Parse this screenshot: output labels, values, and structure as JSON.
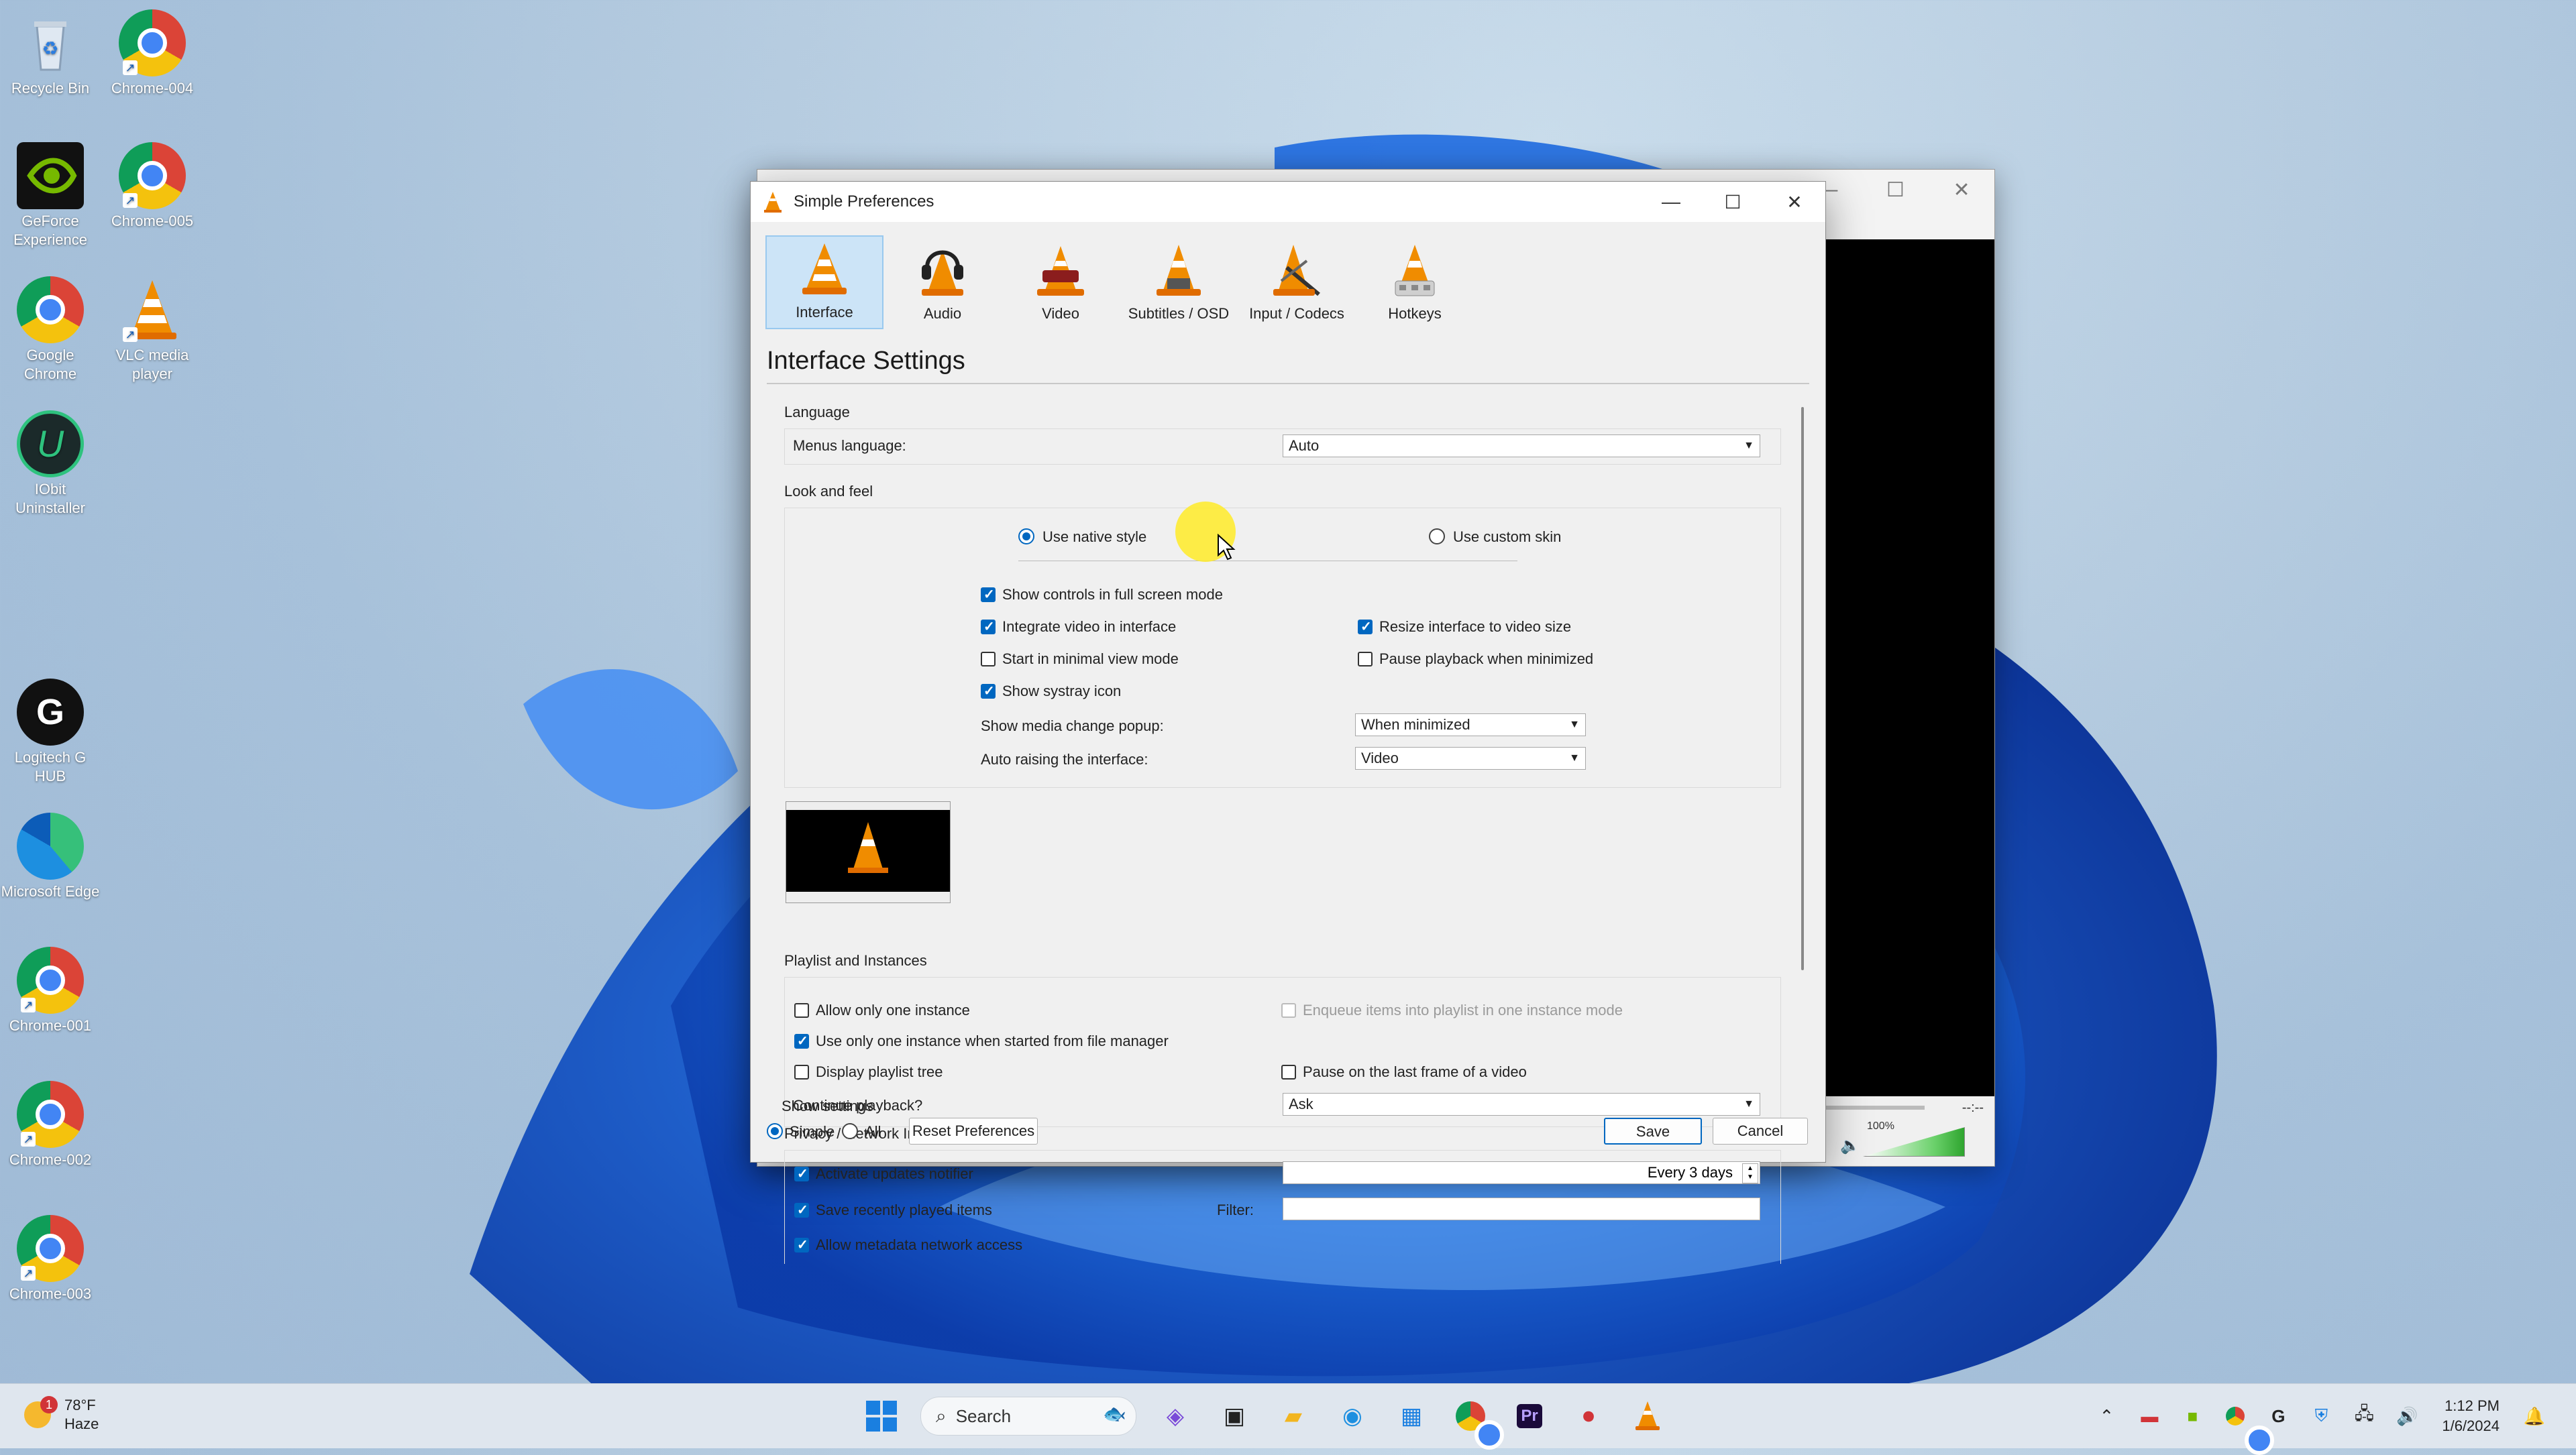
{
  "desktop": {
    "icons": [
      {
        "label": "Recycle Bin"
      },
      {
        "label": "Chrome-004"
      },
      {
        "label": "GeForce Experience"
      },
      {
        "label": "Chrome-005"
      },
      {
        "label": "Google Chrome"
      },
      {
        "label": "VLC media player"
      },
      {
        "label": "IObit Uninstaller"
      },
      {
        "label": "Logitech G HUB"
      },
      {
        "label": "Microsoft Edge"
      },
      {
        "label": "Chrome-001"
      },
      {
        "label": "Chrome-002"
      },
      {
        "label": "Chrome-003"
      }
    ]
  },
  "vlc_back": {
    "volume": "100%",
    "time": "--:--"
  },
  "dialog": {
    "title": "Simple Preferences",
    "tabs": [
      {
        "label": "Interface",
        "icon": "vlc-cone-icon",
        "active": true
      },
      {
        "label": "Audio",
        "icon": "headphones-cone-icon"
      },
      {
        "label": "Video",
        "icon": "video-cone-icon"
      },
      {
        "label": "Subtitles / OSD",
        "icon": "subtitles-cone-icon"
      },
      {
        "label": "Input / Codecs",
        "icon": "codecs-cone-icon"
      },
      {
        "label": "Hotkeys",
        "icon": "hotkeys-cone-icon"
      }
    ],
    "page_title": "Interface Settings",
    "language": {
      "group": "Language",
      "menus_language_label": "Menus language:",
      "menus_language_value": "Auto"
    },
    "look": {
      "group": "Look and feel",
      "native_style": "Use native style",
      "custom_skin": "Use custom skin",
      "show_controls_fullscreen": "Show controls in full screen mode",
      "integrate_video": "Integrate video in interface",
      "resize_interface": "Resize interface to video size",
      "minimal_view": "Start in minimal view mode",
      "pause_minimized": "Pause playback when minimized",
      "systray": "Show systray icon",
      "media_popup_label": "Show media change popup:",
      "media_popup_value": "When minimized",
      "auto_raise_label": "Auto raising the interface:",
      "auto_raise_value": "Video"
    },
    "playlist": {
      "group": "Playlist and Instances",
      "one_instance": "Allow only one instance",
      "enqueue": "Enqueue items into playlist in one instance mode",
      "one_instance_fm": "Use only one instance when started from file manager",
      "playlist_tree": "Display playlist tree",
      "pause_last_frame": "Pause on the last frame of a video",
      "continue_label": "Continue playback?",
      "continue_value": "Ask"
    },
    "privacy": {
      "group": "Privacy / Network Interaction",
      "updates": "Activate updates notifier",
      "updates_value": "Every 3 days",
      "recent": "Save recently played items",
      "filter_label": "Filter:",
      "metadata": "Allow metadata network access"
    },
    "footer": {
      "show_settings": "Show settings",
      "simple": "Simple",
      "all": "All",
      "reset": "Reset Preferences",
      "save": "Save",
      "cancel": "Cancel"
    }
  },
  "taskbar": {
    "weather_badge": "1",
    "temperature": "78°F",
    "condition": "Haze",
    "search_placeholder": "Search",
    "time": "1:12 PM",
    "date": "1/6/2024"
  },
  "colors": {
    "accent": "#0067c0",
    "active_tab": "#cce4f7"
  }
}
